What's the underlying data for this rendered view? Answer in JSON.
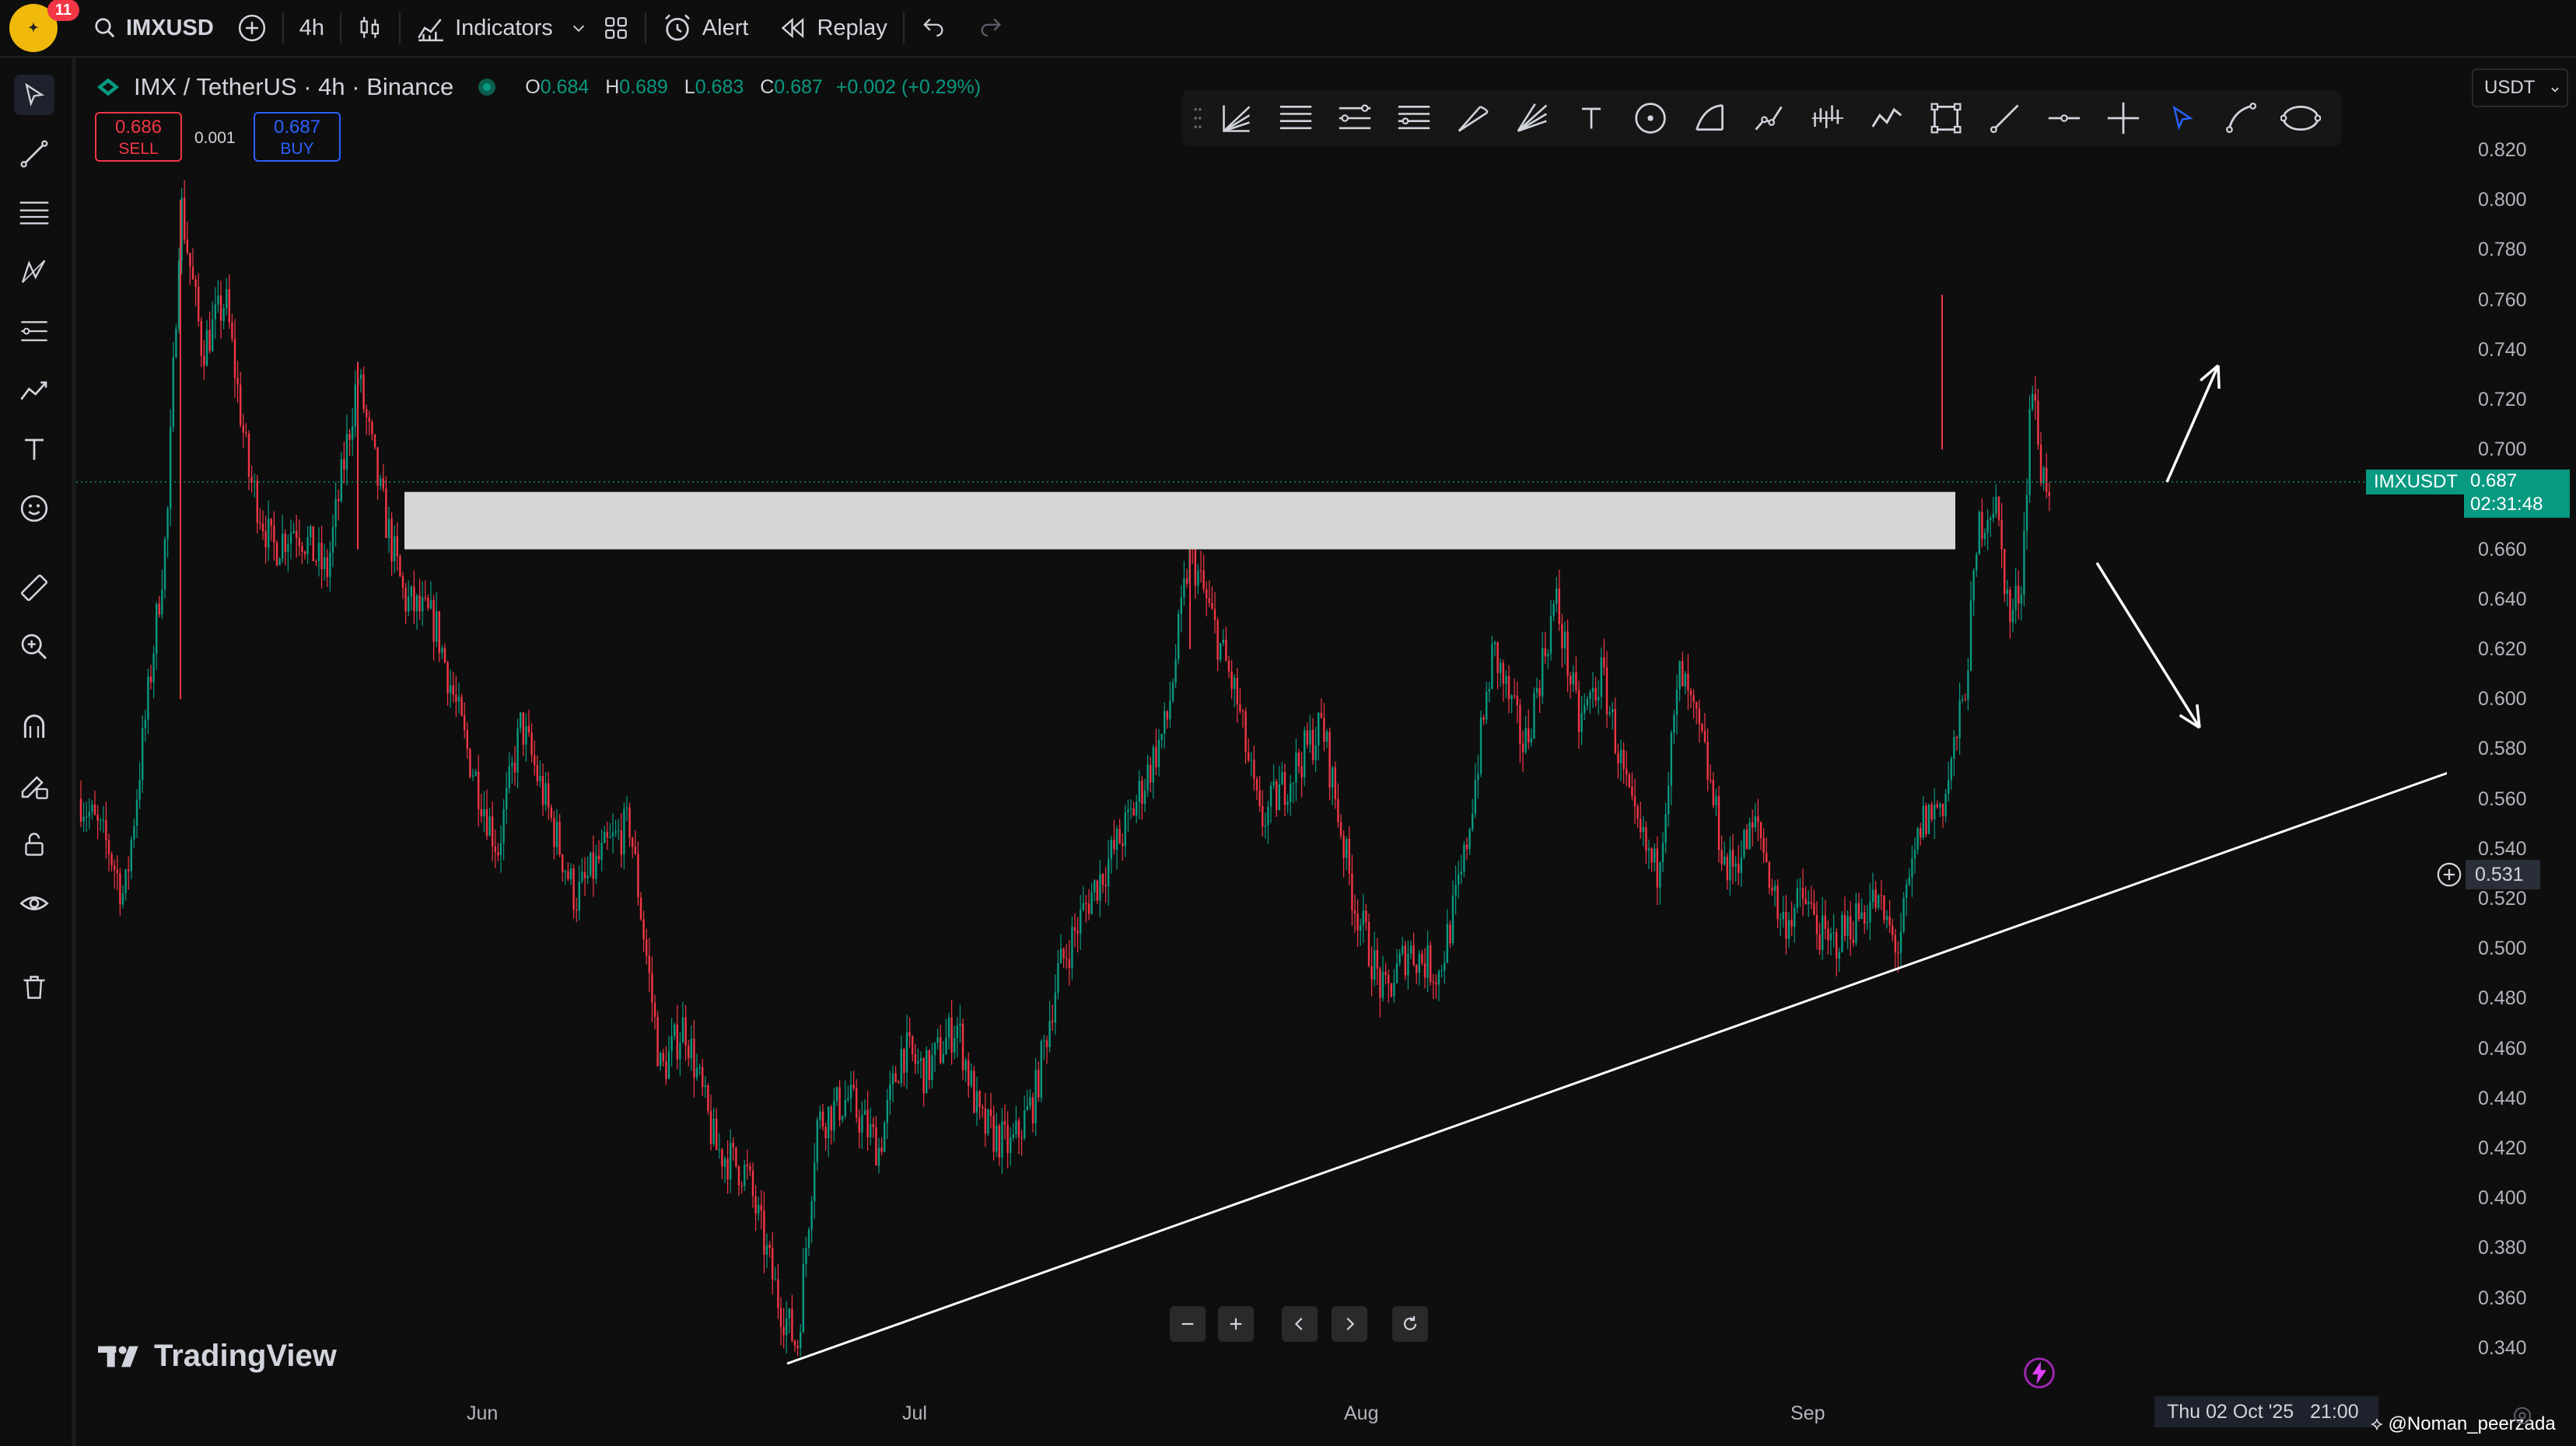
{
  "topbar": {
    "notification_count": "11",
    "symbol": "IMXUSD",
    "interval": "4h",
    "indicators_label": "Indicators",
    "alert_label": "Alert",
    "replay_label": "Replay"
  },
  "legend": {
    "title": "IMX / TetherUS · 4h · Binance",
    "open_key": "O",
    "open": "0.684",
    "high_key": "H",
    "high": "0.689",
    "low_key": "L",
    "low": "0.683",
    "close_key": "C",
    "close": "0.687",
    "change": "+0.002 (+0.29%)",
    "sell_price": "0.686",
    "sell_label": "SELL",
    "spread": "0.001",
    "buy_price": "0.687",
    "buy_label": "BUY"
  },
  "currency": "USDT",
  "price_scale": [
    "0.820",
    "0.800",
    "0.780",
    "0.760",
    "0.740",
    "0.720",
    "0.700",
    "0.680",
    "0.660",
    "0.640",
    "0.620",
    "0.600",
    "0.580",
    "0.560",
    "0.540",
    "0.520",
    "0.500",
    "0.480",
    "0.460",
    "0.440",
    "0.420",
    "0.400",
    "0.380",
    "0.360",
    "0.340"
  ],
  "last_price": {
    "symbol": "IMXUSDT",
    "price": "0.687",
    "countdown": "02:31:48"
  },
  "crosshair_price": "0.531",
  "time_scale": [
    "Jun",
    "Jul",
    "Aug",
    "Sep"
  ],
  "crosshair_time": "Thu 02 Oct '25   21:00",
  "watermark": "TradingView",
  "author": "@Noman_peerzada",
  "colors": {
    "up": "#089981",
    "down": "#f23645",
    "accent": "#2962ff",
    "zone": "#d6d6d6"
  },
  "chart_data": {
    "type": "candlestick",
    "symbol": "IMX / TetherUS",
    "interval": "4h",
    "x_ticks": [
      "Jun",
      "Jul",
      "Aug",
      "Sep"
    ],
    "ylim": [
      0.33,
      0.83
    ],
    "key_points": [
      {
        "x": "late May",
        "close": 0.56
      },
      {
        "x": "start May",
        "high": 0.8
      },
      {
        "x": "late Jun",
        "low": 0.335
      },
      {
        "x": "mid Jul",
        "high": 0.67
      },
      {
        "x": "early Aug",
        "low": 0.47
      },
      {
        "x": "late Aug",
        "low": 0.48
      },
      {
        "x": "late Sep",
        "high": 0.76
      },
      {
        "x": "now",
        "close": 0.687
      }
    ],
    "resistance_zone": [
      0.66,
      0.683
    ],
    "trendline": [
      {
        "x": "late Jun",
        "y": 0.335
      },
      {
        "x": "late Sep",
        "y": 0.58
      }
    ],
    "arrows": [
      "up",
      "down"
    ]
  }
}
